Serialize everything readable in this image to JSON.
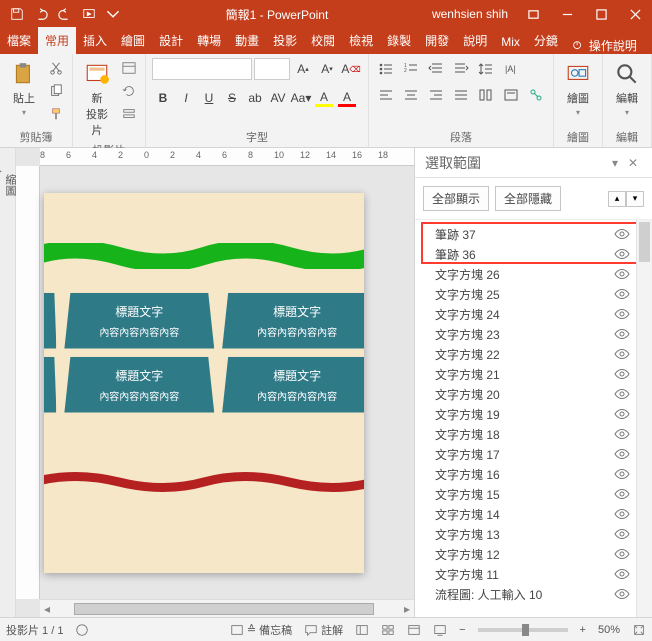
{
  "title": "簡報1 - PowerPoint",
  "user": "wenhsien shih",
  "tabs": [
    "檔案",
    "常用",
    "插入",
    "繪圖",
    "設計",
    "轉場",
    "動畫",
    "投影",
    "校閱",
    "檢視",
    "錄製",
    "開發",
    "說明",
    "Mix",
    "分鏡"
  ],
  "active_tab_index": 1,
  "tell_me": "操作說明",
  "ribbon": {
    "clipboard": {
      "paste": "貼上",
      "label": "剪貼簿"
    },
    "slides": {
      "new_slide": "新\n投影片",
      "label": "投影片"
    },
    "font": {
      "label": "字型"
    },
    "paragraph": {
      "label": "段落"
    },
    "drawing": {
      "label": "繪圖",
      "btn": "繪圖"
    },
    "editing": {
      "label": "編輯",
      "btn": "編輯"
    }
  },
  "ruler_labels": [
    "8",
    "6",
    "4",
    "2",
    "0",
    "2",
    "4",
    "6",
    "8",
    "10",
    "12",
    "14",
    "16",
    "18"
  ],
  "slide": {
    "card_title": "標題文字",
    "card_body": "內容內容內容內容",
    "partial_body": "內容"
  },
  "selection_pane": {
    "title": "選取範圍",
    "show_all": "全部顯示",
    "hide_all": "全部隱藏",
    "items": [
      "筆跡 37",
      "筆跡 36",
      "文字方塊 26",
      "文字方塊 25",
      "文字方塊 24",
      "文字方塊 23",
      "文字方塊 22",
      "文字方塊 21",
      "文字方塊 20",
      "文字方塊 19",
      "文字方塊 18",
      "文字方塊 17",
      "文字方塊 16",
      "文字方塊 15",
      "文字方塊 14",
      "文字方塊 13",
      "文字方塊 12",
      "文字方塊 11",
      "流程圖: 人工輸入 10"
    ]
  },
  "status": {
    "slide_counter": "投影片 1 / 1",
    "notes": "備忘稿",
    "comments": "註解",
    "zoom": "50%"
  }
}
